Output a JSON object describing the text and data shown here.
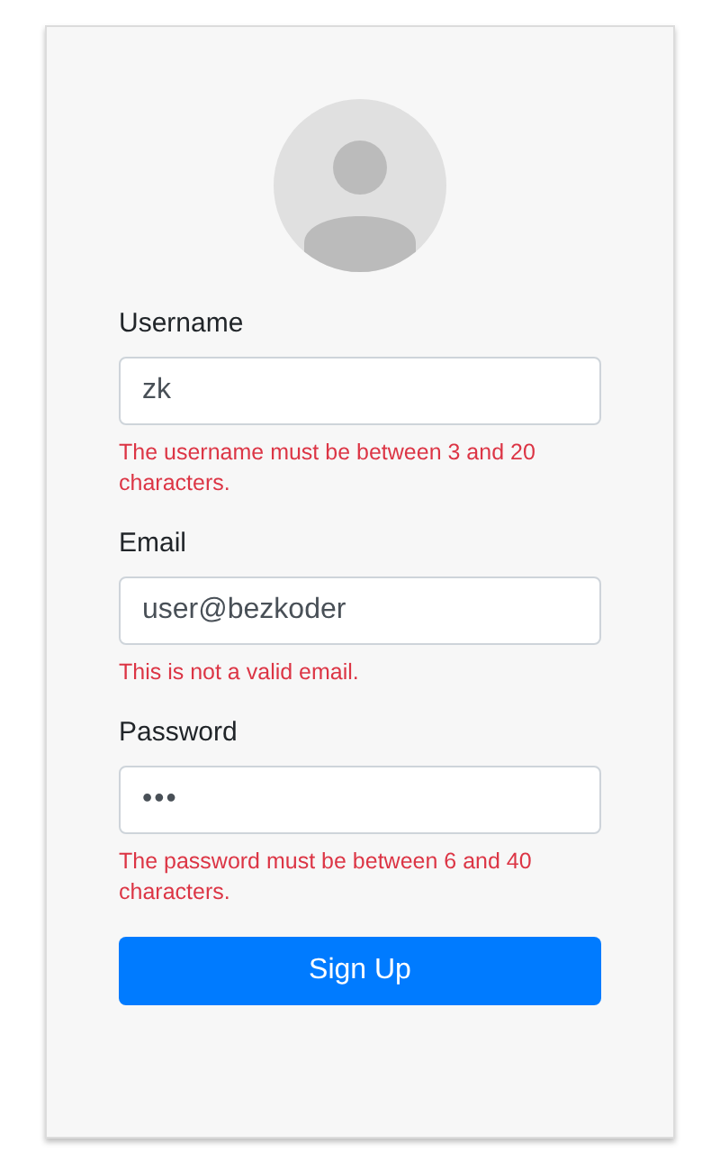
{
  "form": {
    "fields": [
      {
        "kind": "text",
        "label": "Username",
        "value": "zk",
        "error": "The username must be between 3 and 20 characters."
      },
      {
        "kind": "email",
        "label": "Email",
        "value": "user@bezkoder",
        "error": "This is not a valid email."
      },
      {
        "kind": "password",
        "label": "Password",
        "value": "•••",
        "error": "The password must be between 6 and 40 characters."
      }
    ],
    "submit": "Sign Up"
  }
}
